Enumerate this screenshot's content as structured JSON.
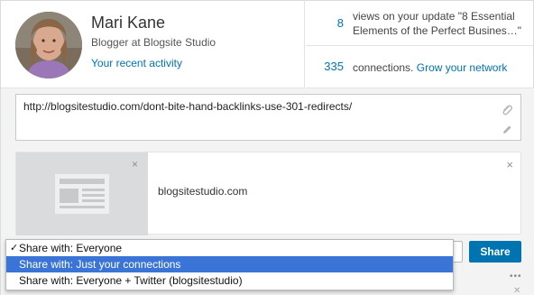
{
  "profile": {
    "name": "Mari Kane",
    "headline": "Blogger at Blogsite Studio",
    "activity_link": "Your recent activity"
  },
  "stats": {
    "views_count": "8",
    "views_text": "views on your update \"8 Essential Elements of the Perfect Busines…\"",
    "connections_count": "335",
    "connections_text": "connections.",
    "grow_link": "Grow your network"
  },
  "share": {
    "url": "http://blogsitestudio.com/dont-bite-hand-backlinks-use-301-redirects/",
    "preview_domain": "blogsitestudio.com",
    "share_button": "Share",
    "close_glyph": "×"
  },
  "visibility_menu": {
    "items": [
      {
        "label": "Share with: Everyone",
        "checked": true,
        "highlighted": false
      },
      {
        "label": "Share with: Just your connections",
        "checked": false,
        "highlighted": true
      },
      {
        "label": "Share with: Everyone + Twitter (blogsitestudio)",
        "checked": false,
        "highlighted": false
      }
    ],
    "check_glyph": "✓"
  },
  "colors": {
    "link_blue": "#0073b1",
    "share_button": "#0073b1",
    "menu_highlight": "#3a74d6"
  },
  "icons": [
    "paperclip-icon",
    "pencil-icon",
    "article-placeholder-icon",
    "close-icon",
    "more-icon"
  ]
}
